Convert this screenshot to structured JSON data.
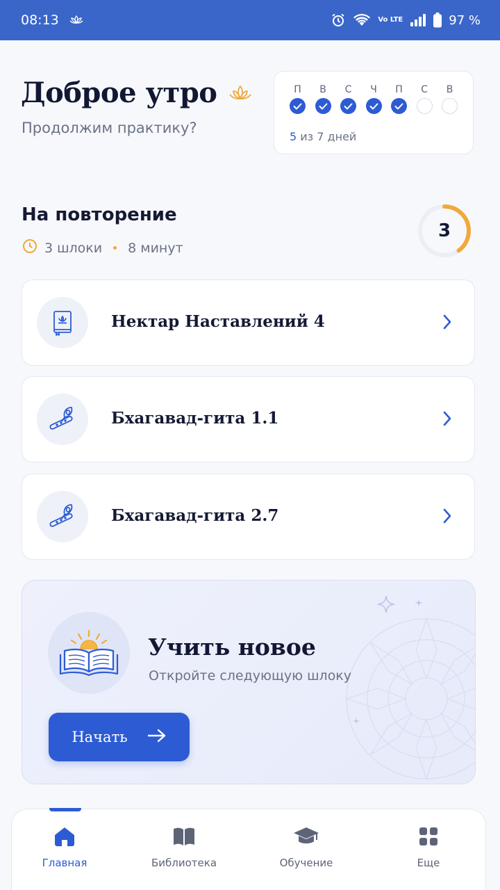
{
  "status_bar": {
    "time": "08:13",
    "network": "Vo LTE",
    "battery": "97 %"
  },
  "greeting": {
    "title": "Доброе утро",
    "subtitle": "Продолжим практику?"
  },
  "week": {
    "days": [
      {
        "label": "П",
        "done": true
      },
      {
        "label": "В",
        "done": true
      },
      {
        "label": "С",
        "done": true
      },
      {
        "label": "Ч",
        "done": true
      },
      {
        "label": "П",
        "done": true
      },
      {
        "label": "С",
        "done": false
      },
      {
        "label": "В",
        "done": false
      }
    ],
    "done_count": "5",
    "progress_suffix": "из 7 дней"
  },
  "review": {
    "title": "На повторение",
    "count_text": "3 шлоки",
    "duration": "8 минут",
    "ring_value": "3",
    "ring_fraction": 0.4,
    "items": [
      {
        "label": "Нектар Наставлений 4",
        "icon": "book-lotus-icon"
      },
      {
        "label": "Бхагавад-гита 1.1",
        "icon": "flute-feather-icon"
      },
      {
        "label": "Бхагавад-гита 2.7",
        "icon": "flute-feather-icon"
      }
    ]
  },
  "learn": {
    "title": "Учить новое",
    "subtitle": "Откройте следующую шлоку",
    "button_label": "Начать"
  },
  "nav": {
    "items": [
      {
        "label": "Главная",
        "icon": "home-icon",
        "active": true
      },
      {
        "label": "Библиотека",
        "icon": "book-icon",
        "active": false
      },
      {
        "label": "Обучение",
        "icon": "graduation-cap-icon",
        "active": false
      },
      {
        "label": "Еще",
        "icon": "grid-icon",
        "active": false
      }
    ]
  },
  "colors": {
    "accent": "#2d5bd4",
    "status_bar": "#3a66c9",
    "ring": "#f0a93a",
    "text_primary": "#141a33",
    "text_secondary": "#6b7286"
  }
}
